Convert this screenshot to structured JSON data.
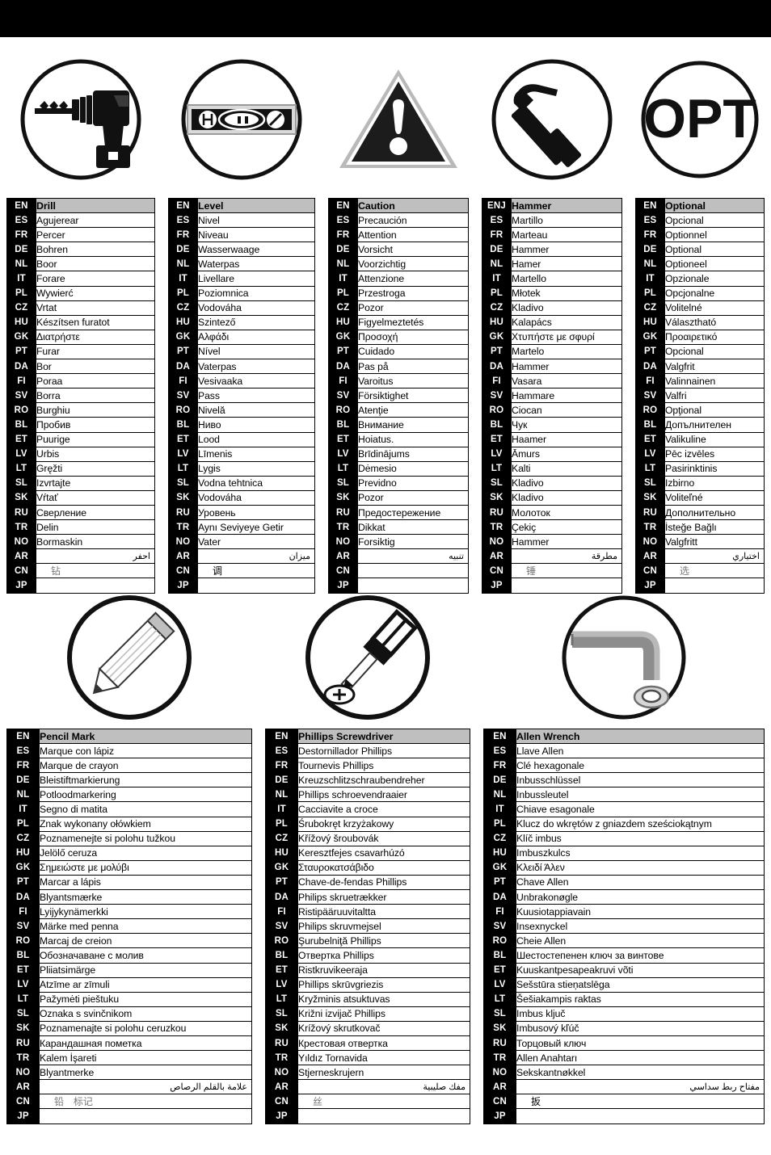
{
  "page": {
    "title": "Multilingual Tool Symbol Legend",
    "top_band_color": "#000000",
    "header_cell_color": "#bfbfbf",
    "code_cell_color": "#000000"
  },
  "language_codes": [
    "EN",
    "ES",
    "FR",
    "DE",
    "NL",
    "IT",
    "PL",
    "CZ",
    "HU",
    "GK",
    "PT",
    "DA",
    "FI",
    "SV",
    "RO",
    "BL",
    "ET",
    "LV",
    "LT",
    "SL",
    "SK",
    "RU",
    "TR",
    "NO",
    "AR",
    "CN",
    "JP"
  ],
  "top_row_icons": [
    {
      "name": "drill-icon",
      "label": "cordless drill in circle"
    },
    {
      "name": "level-icon",
      "label": "spirit level in circle"
    },
    {
      "name": "caution-icon",
      "label": "warning triangle with exclamation mark"
    },
    {
      "name": "hammer-icon",
      "label": "claw hammer in circle"
    },
    {
      "name": "optional-icon",
      "label": "OPT text in circle",
      "text": "OPT"
    }
  ],
  "bottom_row_icons": [
    {
      "name": "pencil-mark-icon",
      "label": "pencil in circle"
    },
    {
      "name": "phillips-screwdriver-icon",
      "label": "phillips screwdriver with screw in circle"
    },
    {
      "name": "allen-wrench-icon",
      "label": "hex key with socket screw in circle"
    }
  ],
  "tables_top": [
    {
      "id": "drill",
      "header_code": "EN",
      "header_term": "Drill",
      "rows": [
        {
          "code": "ES",
          "term": "Agujerear"
        },
        {
          "code": "FR",
          "term": "Percer"
        },
        {
          "code": "DE",
          "term": "Bohren"
        },
        {
          "code": "NL",
          "term": "Boor"
        },
        {
          "code": "IT",
          "term": "Forare"
        },
        {
          "code": "PL",
          "term": "Wywierć"
        },
        {
          "code": "CZ",
          "term": "Vrtat"
        },
        {
          "code": "HU",
          "term": "Készítsen furatot"
        },
        {
          "code": "GK",
          "term": "Διατρήστε"
        },
        {
          "code": "PT",
          "term": "Furar"
        },
        {
          "code": "DA",
          "term": "Bor"
        },
        {
          "code": "FI",
          "term": "Poraa"
        },
        {
          "code": "SV",
          "term": "Borra"
        },
        {
          "code": "RO",
          "term": "Burghiu"
        },
        {
          "code": "BL",
          "term": "Пробив"
        },
        {
          "code": "ET",
          "term": "Puurige"
        },
        {
          "code": "LV",
          "term": "Urbis"
        },
        {
          "code": "LT",
          "term": "Gręžti"
        },
        {
          "code": "SL",
          "term": "Izvrtajte"
        },
        {
          "code": "SK",
          "term": "Vŕtať"
        },
        {
          "code": "RU",
          "term": "Сверление"
        },
        {
          "code": "TR",
          "term": "Delin"
        },
        {
          "code": "NO",
          "term": "Bormaskin"
        },
        {
          "code": "AR",
          "term": "احفر",
          "rtl": true
        },
        {
          "code": "CN",
          "term": "钻",
          "cjk": true
        },
        {
          "code": "JP",
          "term": ""
        }
      ]
    },
    {
      "id": "level",
      "header_code": "EN",
      "header_term": "Level",
      "rows": [
        {
          "code": "ES",
          "term": "Nivel"
        },
        {
          "code": "FR",
          "term": "Niveau"
        },
        {
          "code": "DE",
          "term": "Wasserwaage"
        },
        {
          "code": "NL",
          "term": "Waterpas"
        },
        {
          "code": "IT",
          "term": "Livellare"
        },
        {
          "code": "PL",
          "term": "Poziomnica"
        },
        {
          "code": "CZ",
          "term": "Vodováha"
        },
        {
          "code": "HU",
          "term": "Szintező"
        },
        {
          "code": "GK",
          "term": "Αλφάδι"
        },
        {
          "code": "PT",
          "term": "Nível"
        },
        {
          "code": "DA",
          "term": "Vaterpas"
        },
        {
          "code": "FI",
          "term": "Vesivaaka"
        },
        {
          "code": "SV",
          "term": "Pass"
        },
        {
          "code": "RO",
          "term": "Nivelă"
        },
        {
          "code": "BL",
          "term": "Ниво"
        },
        {
          "code": "ET",
          "term": "Lood"
        },
        {
          "code": "LV",
          "term": "Līmenis"
        },
        {
          "code": "LT",
          "term": "Lygis"
        },
        {
          "code": "SL",
          "term": "Vodna tehtnica"
        },
        {
          "code": "SK",
          "term": "Vodováha"
        },
        {
          "code": "RU",
          "term": "Уровень"
        },
        {
          "code": "TR",
          "term": "Aynı Seviyeye Getir"
        },
        {
          "code": "NO",
          "term": "Vater"
        },
        {
          "code": "AR",
          "term": "ميزان",
          "rtl": true
        },
        {
          "code": "CN",
          "term": "调",
          "cjk": true,
          "dark": true
        },
        {
          "code": "JP",
          "term": ""
        }
      ]
    },
    {
      "id": "caution",
      "header_code": "EN",
      "header_term": "Caution",
      "rows": [
        {
          "code": "ES",
          "term": "Precaución"
        },
        {
          "code": "FR",
          "term": "Attention"
        },
        {
          "code": "DE",
          "term": "Vorsicht"
        },
        {
          "code": "NL",
          "term": "Voorzichtig"
        },
        {
          "code": "IT",
          "term": "Attenzione"
        },
        {
          "code": "PL",
          "term": "Przestroga"
        },
        {
          "code": "CZ",
          "term": "Pozor"
        },
        {
          "code": "HU",
          "term": "Figyelmeztetés"
        },
        {
          "code": "GK",
          "term": "Προσοχή"
        },
        {
          "code": "PT",
          "term": "Cuidado"
        },
        {
          "code": "DA",
          "term": "Pas på"
        },
        {
          "code": "FI",
          "term": "Varoitus"
        },
        {
          "code": "SV",
          "term": "Försiktighet"
        },
        {
          "code": "RO",
          "term": "Atenţie"
        },
        {
          "code": "BL",
          "term": "Внимание"
        },
        {
          "code": "ET",
          "term": "Hoiatus."
        },
        {
          "code": "LV",
          "term": "Brīdinājums"
        },
        {
          "code": "LT",
          "term": "Dėmesio"
        },
        {
          "code": "SL",
          "term": "Previdno"
        },
        {
          "code": "SK",
          "term": "Pozor"
        },
        {
          "code": "RU",
          "term": "Предостережение"
        },
        {
          "code": "TR",
          "term": "Dikkat"
        },
        {
          "code": "NO",
          "term": "Forsiktig"
        },
        {
          "code": "AR",
          "term": "تنبيه",
          "rtl": true
        },
        {
          "code": "CN",
          "term": ""
        },
        {
          "code": "JP",
          "term": ""
        }
      ]
    },
    {
      "id": "hammer",
      "header_code": "ENJ",
      "header_term": "Hammer",
      "rows": [
        {
          "code": "ES",
          "term": "Martillo"
        },
        {
          "code": "FR",
          "term": "Marteau"
        },
        {
          "code": "DE",
          "term": "Hammer"
        },
        {
          "code": "NL",
          "term": "Hamer"
        },
        {
          "code": "IT",
          "term": "Martello"
        },
        {
          "code": "PL",
          "term": "Młotek"
        },
        {
          "code": "CZ",
          "term": "Kladivo"
        },
        {
          "code": "HU",
          "term": "Kalapács"
        },
        {
          "code": "GK",
          "term": "Χτυπήστε με σφυρί"
        },
        {
          "code": "PT",
          "term": "Martelo"
        },
        {
          "code": "DA",
          "term": "Hammer"
        },
        {
          "code": "FI",
          "term": "Vasara"
        },
        {
          "code": "SV",
          "term": "Hammare"
        },
        {
          "code": "RO",
          "term": "Ciocan"
        },
        {
          "code": "BL",
          "term": "Чук"
        },
        {
          "code": "ET",
          "term": "Haamer"
        },
        {
          "code": "LV",
          "term": "Āmurs"
        },
        {
          "code": "LT",
          "term": "Kalti"
        },
        {
          "code": "SL",
          "term": "Kladivo"
        },
        {
          "code": "SK",
          "term": "Kladivo"
        },
        {
          "code": "RU",
          "term": "Молоток"
        },
        {
          "code": "TR",
          "term": "Çekiç"
        },
        {
          "code": "NO",
          "term": "Hammer"
        },
        {
          "code": "AR",
          "term": "مطرقة",
          "rtl": true
        },
        {
          "code": "CN",
          "term": "锤",
          "cjk": true
        },
        {
          "code": "JP",
          "term": ""
        }
      ]
    },
    {
      "id": "optional",
      "header_code": "EN",
      "header_term": "Optional",
      "rows": [
        {
          "code": "ES",
          "term": "Opcional"
        },
        {
          "code": "FR",
          "term": "Optionnel"
        },
        {
          "code": "DE",
          "term": "Optional"
        },
        {
          "code": "NL",
          "term": "Optioneel"
        },
        {
          "code": "IT",
          "term": "Opzionale"
        },
        {
          "code": "PL",
          "term": "Opcjonalne"
        },
        {
          "code": "CZ",
          "term": "Volitelné"
        },
        {
          "code": "HU",
          "term": "Választható"
        },
        {
          "code": "GK",
          "term": "Προαιρετικό"
        },
        {
          "code": "PT",
          "term": "Opcional"
        },
        {
          "code": "DA",
          "term": "Valgfrit"
        },
        {
          "code": "FI",
          "term": "Valinnainen"
        },
        {
          "code": "SV",
          "term": "Valfri"
        },
        {
          "code": "RO",
          "term": "Opţional"
        },
        {
          "code": "BL",
          "term": "Допълнителен"
        },
        {
          "code": "ET",
          "term": "Valikuline"
        },
        {
          "code": "LV",
          "term": "Pēc izvēles"
        },
        {
          "code": "LT",
          "term": "Pasirinktinis"
        },
        {
          "code": "SL",
          "term": "Izbirno"
        },
        {
          "code": "SK",
          "term": "Voliteľné"
        },
        {
          "code": "RU",
          "term": "Дополнительно"
        },
        {
          "code": "TR",
          "term": "İsteğe Bağlı"
        },
        {
          "code": "NO",
          "term": "Valgfritt"
        },
        {
          "code": "AR",
          "term": "اختياري",
          "rtl": true
        },
        {
          "code": "CN",
          "term": "选",
          "cjk": true
        },
        {
          "code": "JP",
          "term": ""
        }
      ]
    }
  ],
  "tables_bottom": [
    {
      "id": "pencil-mark",
      "header_code": "EN",
      "header_term": "Pencil Mark",
      "rows": [
        {
          "code": "ES",
          "term": "Marque con lápiz"
        },
        {
          "code": "FR",
          "term": "Marque de crayon"
        },
        {
          "code": "DE",
          "term": "Bleistiftmarkierung"
        },
        {
          "code": "NL",
          "term": "Potloodmarkering"
        },
        {
          "code": "IT",
          "term": "Segno di matita"
        },
        {
          "code": "PL",
          "term": "Znak wykonany ołówkiem"
        },
        {
          "code": "CZ",
          "term": "Poznamenejte si polohu tužkou"
        },
        {
          "code": "HU",
          "term": "Jelölő ceruza"
        },
        {
          "code": "GK",
          "term": "Σημειώστε με μολύβι"
        },
        {
          "code": "PT",
          "term": "Marcar a lápis"
        },
        {
          "code": "DA",
          "term": "Blyantsmærke"
        },
        {
          "code": "FI",
          "term": "Lyijykynämerkki"
        },
        {
          "code": "SV",
          "term": "Märke med penna"
        },
        {
          "code": "RO",
          "term": "Marcaj de creion"
        },
        {
          "code": "BL",
          "term": "Обозначаване с молив"
        },
        {
          "code": "ET",
          "term": "Pliiatsimärge"
        },
        {
          "code": "LV",
          "term": "Atzīme ar zīmuli"
        },
        {
          "code": "LT",
          "term": "Pažymėti pieštuku"
        },
        {
          "code": "SL",
          "term": "Oznaka s svinčnikom"
        },
        {
          "code": "SK",
          "term": "Poznamenajte si polohu ceruzkou"
        },
        {
          "code": "RU",
          "term": "Карандашная пометка"
        },
        {
          "code": "TR",
          "term": "Kalem İşareti"
        },
        {
          "code": "NO",
          "term": "Blyantmerke"
        },
        {
          "code": "AR",
          "term": "علامة بالقلم الرصاص",
          "rtl": true
        },
        {
          "code": "CN",
          "term": "铅　标记",
          "cjk": true
        },
        {
          "code": "JP",
          "term": ""
        }
      ]
    },
    {
      "id": "phillips-screwdriver",
      "header_code": "EN",
      "header_term": "Phillips Screwdriver",
      "rows": [
        {
          "code": "ES",
          "term": "Destornillador Phillips"
        },
        {
          "code": "FR",
          "term": "Tournevis Phillips"
        },
        {
          "code": "DE",
          "term": "Kreuzschlitzschraubendreher"
        },
        {
          "code": "NL",
          "term": "Phillips schroevendraaier"
        },
        {
          "code": "IT",
          "term": "Cacciavite a croce"
        },
        {
          "code": "PL",
          "term": "Śrubokręt krzyżakowy"
        },
        {
          "code": "CZ",
          "term": "Křížový šroubovák"
        },
        {
          "code": "HU",
          "term": "Keresztfejes csavarhúzó"
        },
        {
          "code": "GK",
          "term": "Σταυροκατσάβιδο"
        },
        {
          "code": "PT",
          "term": "Chave-de-fendas Phillips"
        },
        {
          "code": "DA",
          "term": "Philips skruetrækker"
        },
        {
          "code": "FI",
          "term": "Ristipääruuvitaltta"
        },
        {
          "code": "SV",
          "term": "Philips skruvmejsel"
        },
        {
          "code": "RO",
          "term": "Şurubelniţă Phillips"
        },
        {
          "code": "BL",
          "term": "Отвертка Phillips"
        },
        {
          "code": "ET",
          "term": "Ristkruvikeeraja"
        },
        {
          "code": "LV",
          "term": "Phillips skrūvgriezis"
        },
        {
          "code": "LT",
          "term": "Kryžminis atsuktuvas"
        },
        {
          "code": "SL",
          "term": "Križni izvijač Phillips"
        },
        {
          "code": "SK",
          "term": "Krížový skrutkovač"
        },
        {
          "code": "RU",
          "term": "Крестовая отвертка"
        },
        {
          "code": "TR",
          "term": "Yıldız Tornavida"
        },
        {
          "code": "NO",
          "term": "Stjerneskrujern"
        },
        {
          "code": "AR",
          "term": "مفك صليبية",
          "rtl": true
        },
        {
          "code": "CN",
          "term": "丝",
          "cjk": true
        },
        {
          "code": "JP",
          "term": ""
        }
      ]
    },
    {
      "id": "allen-wrench",
      "header_code": "EN",
      "header_term": "Allen Wrench",
      "rows": [
        {
          "code": "ES",
          "term": "Llave Allen"
        },
        {
          "code": "FR",
          "term": "Clé hexagonale"
        },
        {
          "code": "DE",
          "term": "Inbusschlüssel"
        },
        {
          "code": "NL",
          "term": "Inbussleutel"
        },
        {
          "code": "IT",
          "term": "Chiave esagonale"
        },
        {
          "code": "PL",
          "term": "Klucz do wkrętów z gniazdem sześciokątnym"
        },
        {
          "code": "CZ",
          "term": "Klíč imbus"
        },
        {
          "code": "HU",
          "term": "Imbuszkulcs"
        },
        {
          "code": "GK",
          "term": "Κλειδί Άλεν"
        },
        {
          "code": "PT",
          "term": "Chave Allen"
        },
        {
          "code": "DA",
          "term": "Unbrakonøgle"
        },
        {
          "code": "FI",
          "term": "Kuusiotappiavain"
        },
        {
          "code": "SV",
          "term": "Insexnyckel"
        },
        {
          "code": "RO",
          "term": "Cheie Allen"
        },
        {
          "code": "BL",
          "term": "Шестостепенен ключ за винтове"
        },
        {
          "code": "ET",
          "term": "Kuuskantpesapeakruvi võti"
        },
        {
          "code": "LV",
          "term": "Sešstūra stieņatslēga"
        },
        {
          "code": "LT",
          "term": "Šešiakampis raktas"
        },
        {
          "code": "SL",
          "term": "Imbus ključ"
        },
        {
          "code": "SK",
          "term": "Imbusový kľúč"
        },
        {
          "code": "RU",
          "term": "Торцовый ключ"
        },
        {
          "code": "TR",
          "term": "Allen Anahtarı"
        },
        {
          "code": "NO",
          "term": "Sekskantnøkkel"
        },
        {
          "code": "AR",
          "term": "مفتاح ربط سداسي",
          "rtl": true
        },
        {
          "code": "CN",
          "term": "扳",
          "cjk": true,
          "dark": true
        },
        {
          "code": "JP",
          "term": ""
        }
      ]
    }
  ]
}
